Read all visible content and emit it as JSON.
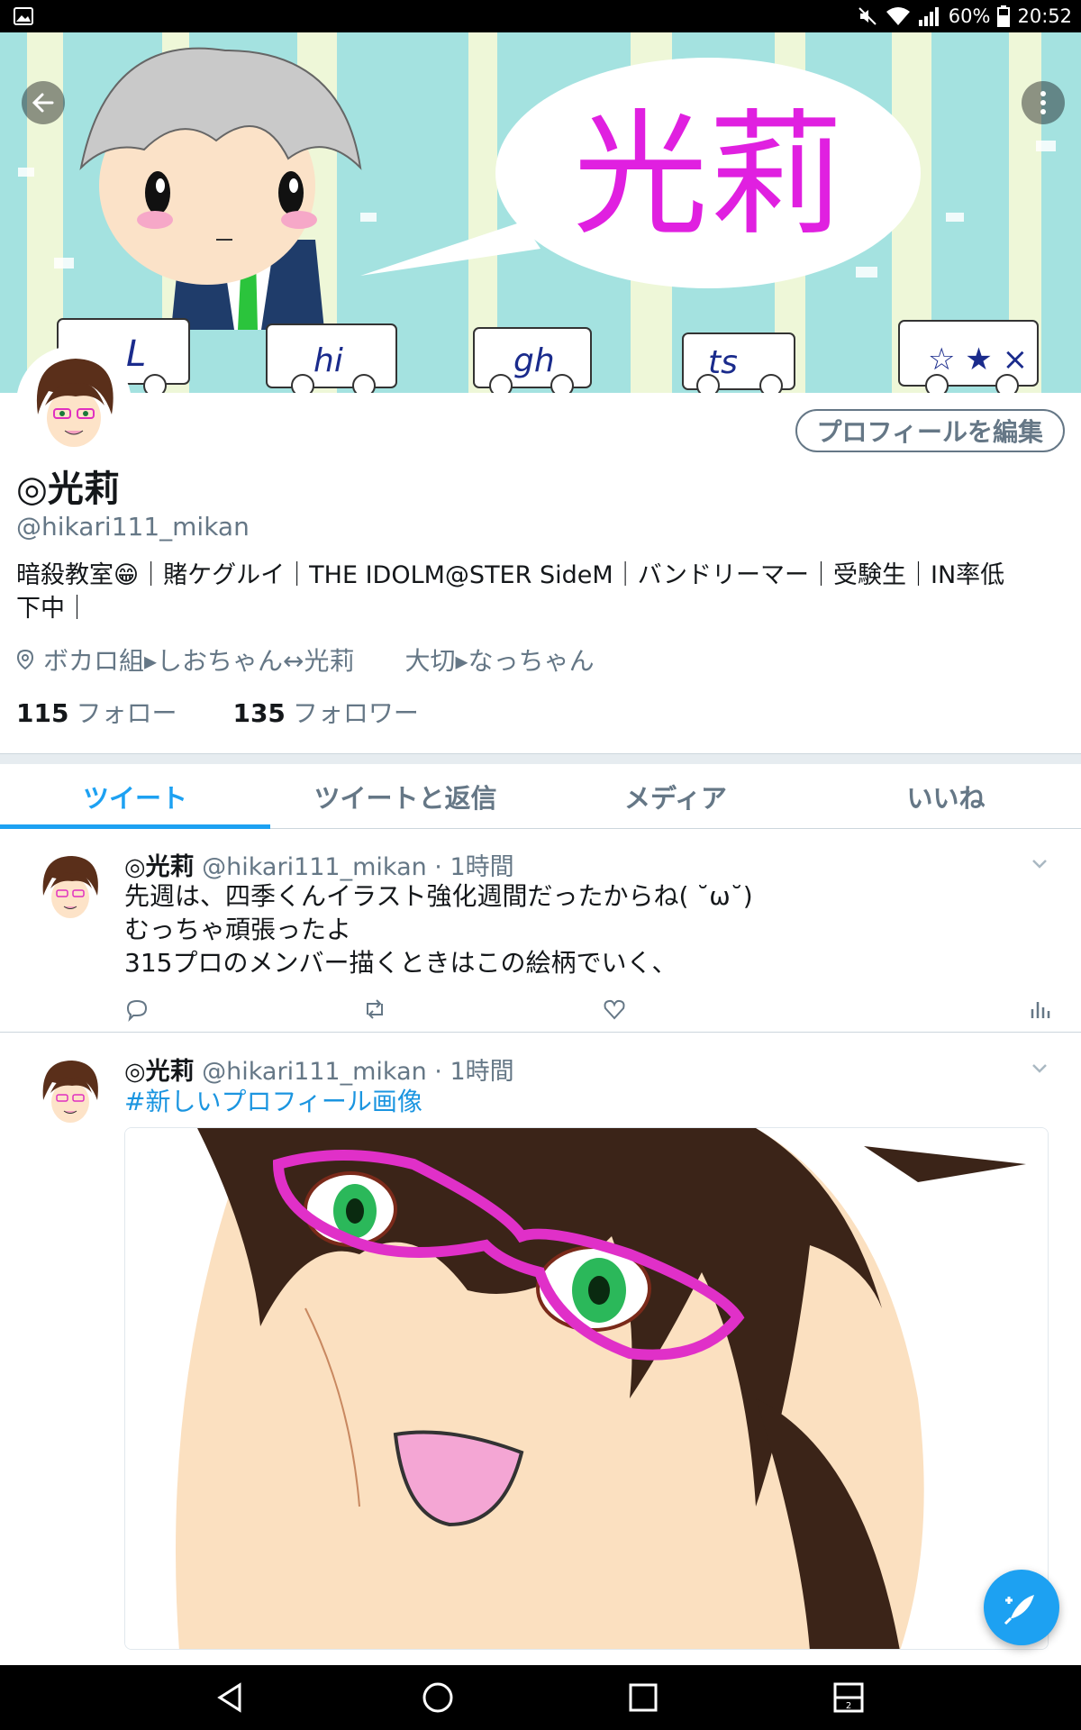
{
  "status_bar": {
    "battery": "60%",
    "time": "20:52",
    "icons": [
      "image-notification-icon",
      "mute-icon",
      "wifi-icon",
      "signal-icon",
      "battery-icon"
    ]
  },
  "header": {
    "banner_text": "光莉",
    "banner_signs": [
      "hi",
      "gh",
      "ts"
    ],
    "back_icon": "arrow-left-icon",
    "more_icon": "more-vertical-icon"
  },
  "profile": {
    "edit_label": "プロフィールを編集",
    "name": "◎光莉",
    "handle": "@hikari111_mikan",
    "bio_line1": "暗殺教室😁｜賭ケグルイ｜THE IDOLM@STER  SideM｜バンドリーマー｜受験生｜IN率低",
    "bio_line2": "下中｜",
    "location": "ボカロ組▸しおちゃん↔光莉",
    "website": "大切▸なっちゃん",
    "following_count": "115",
    "following_label": "フォロー",
    "followers_count": "135",
    "followers_label": "フォロワー"
  },
  "tabs": [
    {
      "label": "ツイート",
      "active": true
    },
    {
      "label": "ツイートと返信",
      "active": false
    },
    {
      "label": "メディア",
      "active": false
    },
    {
      "label": "いいね",
      "active": false
    }
  ],
  "tweets": [
    {
      "name": "◎光莉",
      "handle_time": " @hikari111_mikan · 1時間",
      "lines": [
        "先週は、四季くんイラスト強化週間だったからね( ˘ω˘)",
        "むっちゃ頑張ったよ",
        "315プロのメンバー描くときはこの絵柄でいく、"
      ]
    },
    {
      "name": "◎光莉",
      "handle_time": " @hikari111_mikan · 1時間",
      "hashtag": "#新しいプロフィール画像"
    }
  ],
  "colors": {
    "accent": "#1da1f2",
    "secondary_text": "#657786",
    "primary_text": "#14171a",
    "banner_bg": "#9fe0e0",
    "banner_text": "#e020e0"
  }
}
